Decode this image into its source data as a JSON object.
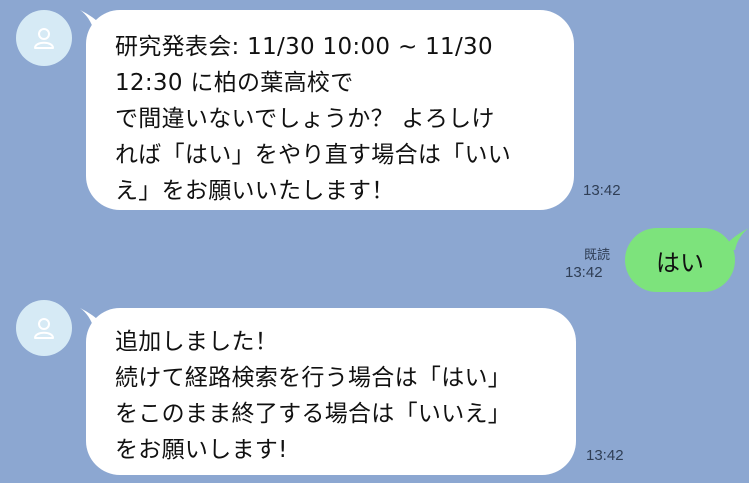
{
  "messages": [
    {
      "sender": "bot",
      "lines": [
        "研究発表会: 11/30 10:00 ~ 11/30",
        "12:30 に柏の葉高校で",
        "で間違いないでしょうか？ よろしけ",
        "れば「はい」をやり直す場合は「いい",
        "え」をお願いいたします！"
      ],
      "time": "13:42"
    },
    {
      "sender": "me",
      "text": "はい",
      "read": "既読",
      "time": "13:42"
    },
    {
      "sender": "bot",
      "lines": [
        "追加しました！",
        "続けて経路検索を行う場合は「はい」",
        "をこのまま終了する場合は「いいえ」",
        "をお願いします!"
      ],
      "time": "13:42"
    }
  ],
  "colors": {
    "background": "#8ca7d1",
    "incoming_bubble": "#ffffff",
    "outgoing_bubble": "#7de37c",
    "avatar": "#d6eaf5"
  },
  "icons": {
    "avatar": "user-silhouette-icon"
  }
}
